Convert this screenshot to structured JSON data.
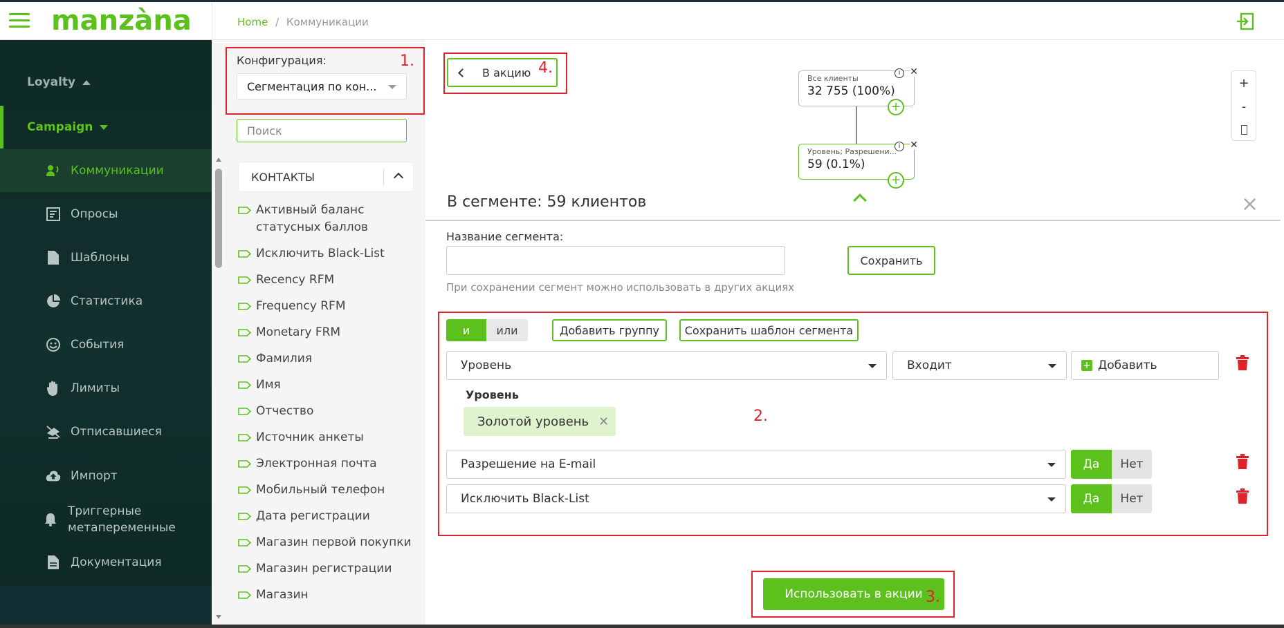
{
  "app": {
    "logo": "manzàna"
  },
  "breadcrumb": {
    "home": "Home",
    "separator": "/",
    "current": "Коммуникации"
  },
  "sidebar": {
    "sections": [
      {
        "label": "Loyalty"
      },
      {
        "label": "Campaign"
      }
    ],
    "items": [
      {
        "label": "Коммуникации",
        "icon": "megaphone-icon"
      },
      {
        "label": "Опросы",
        "icon": "survey-icon"
      },
      {
        "label": "Шаблоны",
        "icon": "document-icon"
      },
      {
        "label": "Статистика",
        "icon": "pie-chart-icon"
      },
      {
        "label": "События",
        "icon": "smile-icon"
      },
      {
        "label": "Лимиты",
        "icon": "hand-icon"
      },
      {
        "label": "Отписавшиеся",
        "icon": "unsubscribe-icon"
      },
      {
        "label": "Импорт",
        "icon": "cloud-upload-icon"
      },
      {
        "label": "Триггерные метапеременные",
        "icon": "bell-icon"
      },
      {
        "label": "Документация",
        "icon": "file-text-icon"
      }
    ]
  },
  "config": {
    "label": "Конфигурация:",
    "value": "Сегментация по кон..."
  },
  "search": {
    "placeholder": "Поиск"
  },
  "contacts": {
    "header": "КОНТАКТЫ",
    "fields": [
      "Активный баланс статусных баллов",
      "Исключить Black-List",
      "Recency RFM",
      "Frequency RFM",
      "Monetary FRM",
      "Фамилия",
      "Имя",
      "Отчество",
      "Источник анкеты",
      "Электронная почта",
      "Мобильный телефон",
      "Дата регистрации",
      "Магазин первой покупки",
      "Магазин регистрации",
      "Магазин"
    ]
  },
  "back_button": {
    "label": "В акцию"
  },
  "tree": {
    "nodes": [
      {
        "label": "Все клиенты",
        "value": "32 755 (100%)"
      },
      {
        "label": "Уровень; Разрешени...",
        "value": "59 (0.1%)"
      }
    ]
  },
  "zoom": {
    "in": "+",
    "out": "-"
  },
  "segment": {
    "header": "В сегменте: 59 клиентов",
    "name_label": "Название сегмента:",
    "name_value": "",
    "save_label": "Сохранить",
    "hint": "При сохранении сегмент можно использовать в других акциях"
  },
  "logic": {
    "and": "и",
    "or": "или"
  },
  "actions": {
    "add_group": "Добавить группу",
    "save_template": "Сохранить шаблон сегмента"
  },
  "conditions": {
    "c1": {
      "field": "Уровень",
      "operator": "Входит",
      "add": "Добавить",
      "sub_label": "Уровень",
      "chip": "Золотой уровень"
    },
    "c2": {
      "field": "Разрешение на E-mail",
      "yes": "Да",
      "no": "Нет"
    },
    "c3": {
      "field": "Исключить Black-List",
      "yes": "Да",
      "no": "Нет"
    }
  },
  "use_button": {
    "label": "Использовать в акции"
  },
  "annotations": {
    "n1": "1.",
    "n2": "2.",
    "n3": "3.",
    "n4": "4."
  },
  "colors": {
    "accent": "#5cc11c",
    "annotation": "#e0222a",
    "sidebar": "#0e2a26",
    "danger": "#e0222a"
  }
}
